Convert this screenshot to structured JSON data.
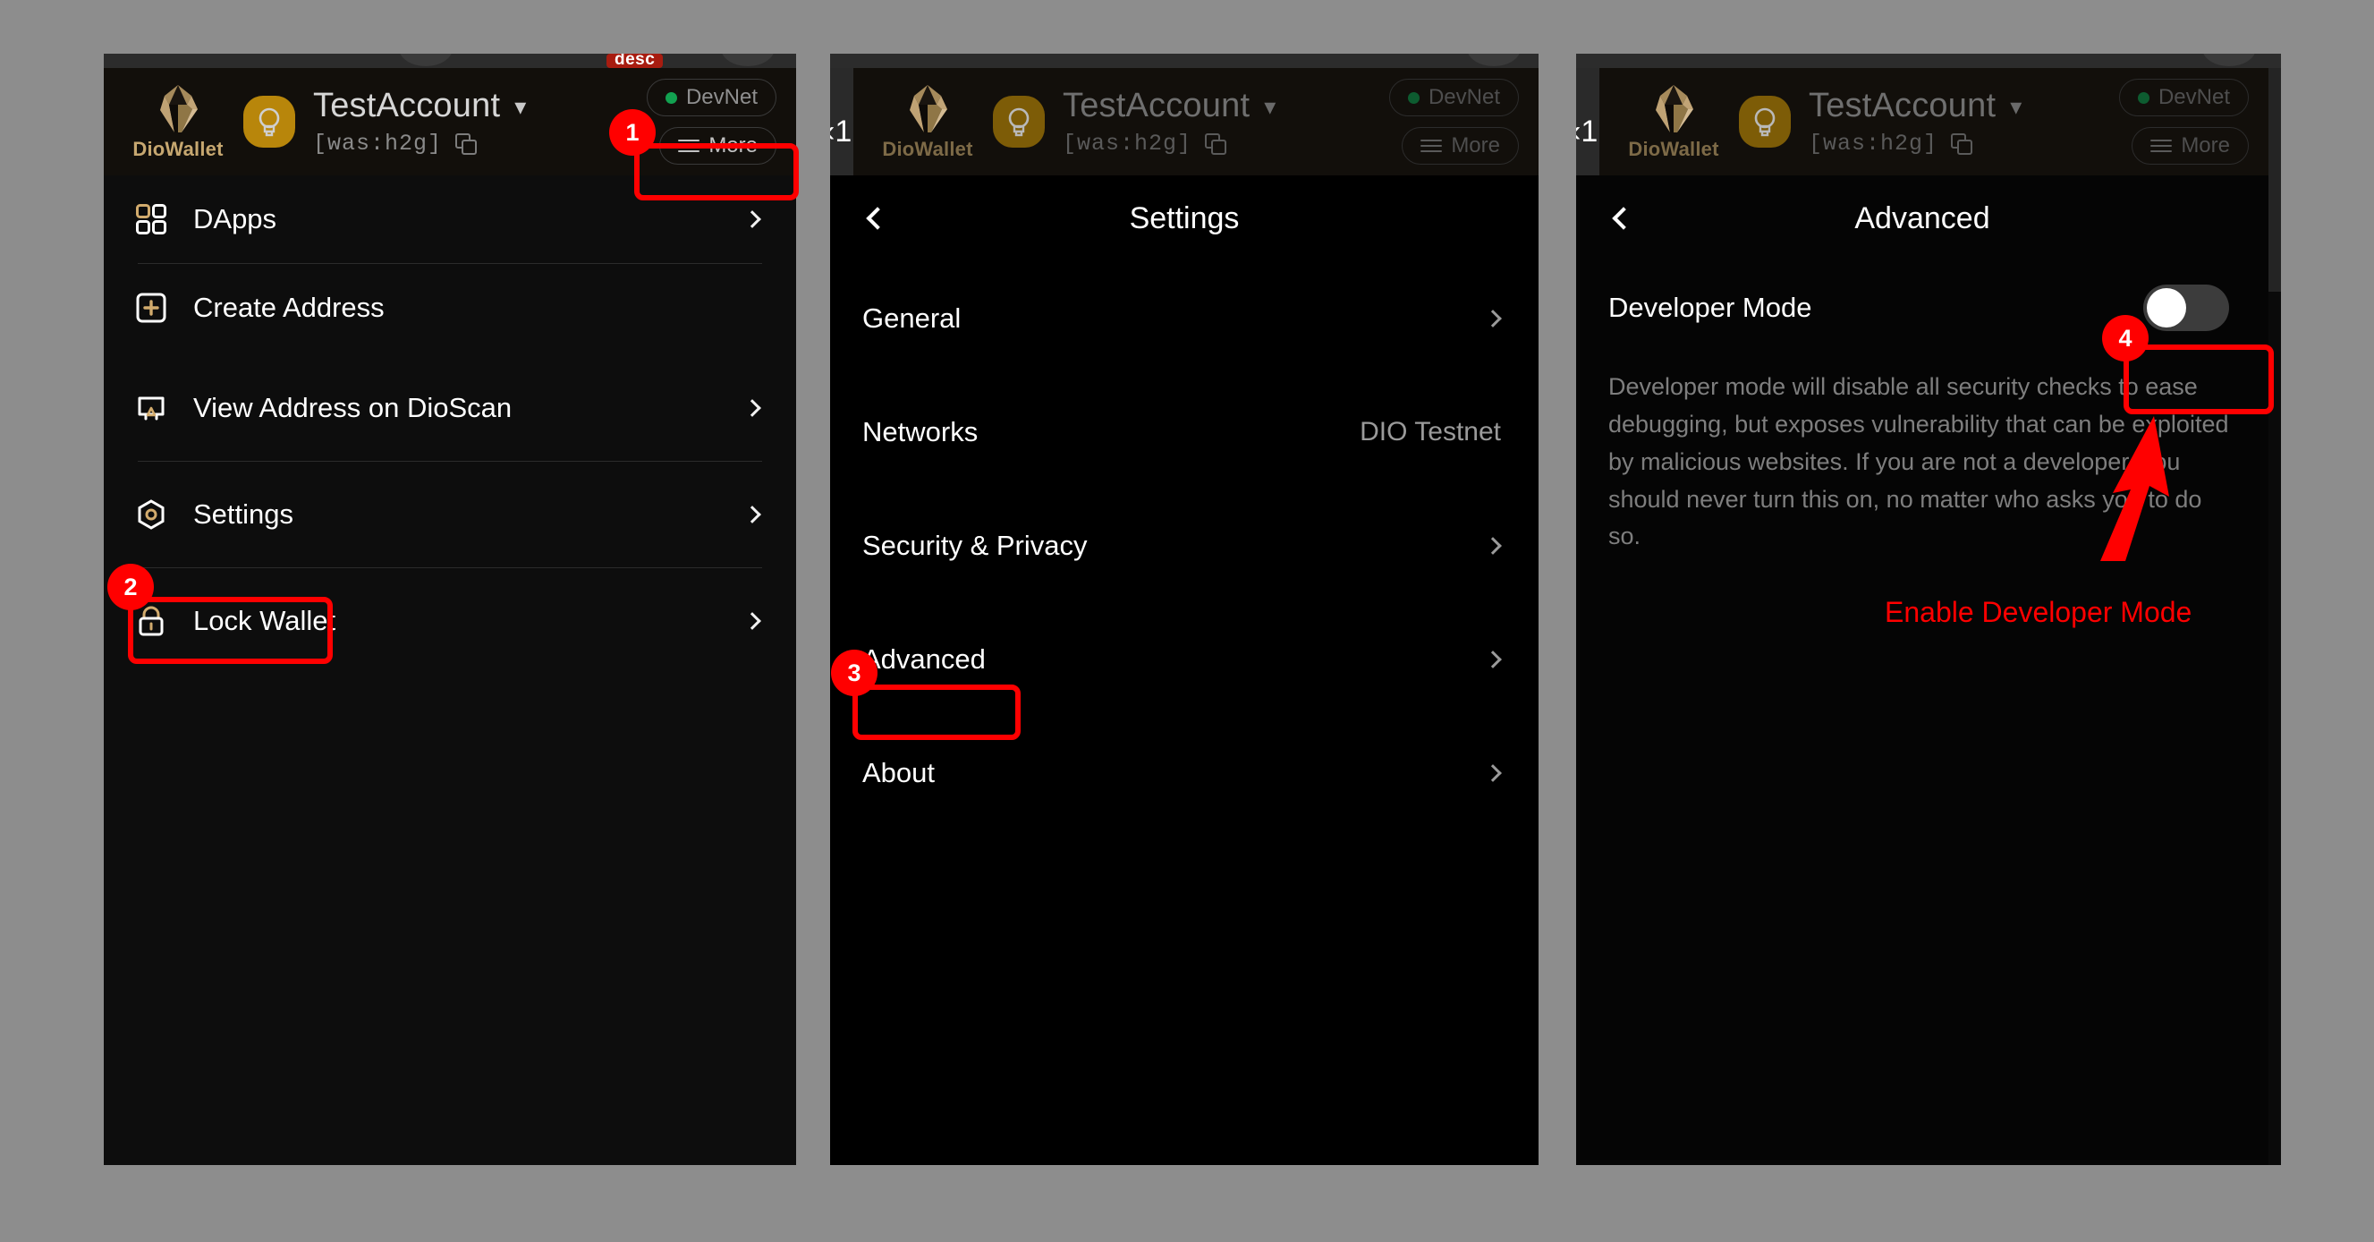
{
  "app": {
    "brand_name": "DioWallet",
    "account_name": "TestAccount",
    "account_address": "[was:h2g]",
    "network_badge": "DevNet",
    "more_label": "More",
    "chrome_badge": "desc"
  },
  "panel1": {
    "menu": [
      {
        "label": "DApps",
        "icon": "grid-icon",
        "chevron": true
      },
      {
        "label": "Create Address",
        "icon": "plus-square-icon",
        "chevron": false
      },
      {
        "label": "View Address on DioScan",
        "icon": "external-screen-icon",
        "chevron": true
      },
      {
        "label": "Settings",
        "icon": "gear-hex-icon",
        "chevron": true
      },
      {
        "label": "Lock Wallet",
        "icon": "lock-icon",
        "chevron": true
      }
    ]
  },
  "panel2": {
    "title": "Settings",
    "items": [
      {
        "label": "General",
        "value": "",
        "chevron": true
      },
      {
        "label": "Networks",
        "value": "DIO Testnet",
        "chevron": false
      },
      {
        "label": "Security & Privacy",
        "value": "",
        "chevron": true
      },
      {
        "label": "Advanced",
        "value": "",
        "chevron": true
      },
      {
        "label": "About",
        "value": "",
        "chevron": true
      }
    ]
  },
  "panel3": {
    "title": "Advanced",
    "developer_mode_label": "Developer Mode",
    "developer_mode_on": false,
    "description": "Developer mode will disable all security checks to ease debugging, but exposes vulnerability that can be exploited by malicious websites. If you are not a developer, you should never turn this on, no matter who asks you to do so.",
    "callout": "Enable Developer Mode"
  },
  "annotations": {
    "step1": "1",
    "step2": "2",
    "step3": "3",
    "step4": "4",
    "accent": "#ff0000"
  }
}
